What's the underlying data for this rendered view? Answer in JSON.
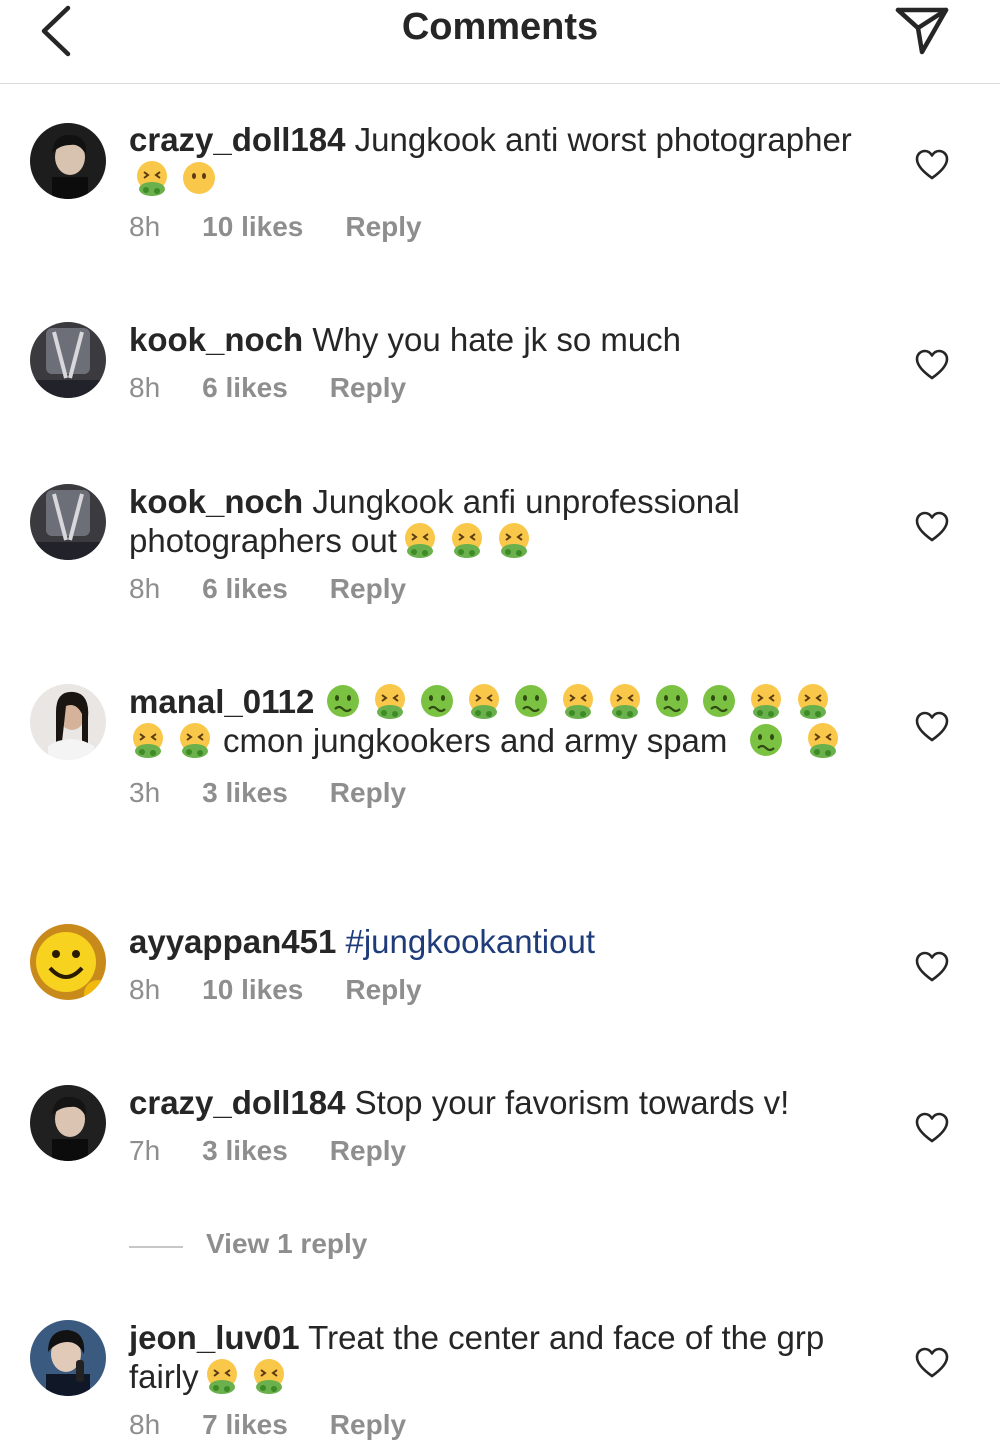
{
  "header": {
    "title": "Comments",
    "back_icon": "chevron-left-icon",
    "send_icon": "paper-plane-icon"
  },
  "colors": {
    "text": "#262626",
    "meta": "#8e8e8e",
    "hashtag": "#1f3c7a",
    "divider": "#dbdbdb"
  },
  "comments": [
    {
      "username": "crazy_doll184",
      "text_parts": [
        "Jungkook anti worst photographer"
      ],
      "emojis_after": [
        "nauseated-face-icon",
        "face-without-mouth-icon"
      ],
      "time": "8h",
      "likes": "10 likes",
      "reply": "Reply"
    },
    {
      "username": "kook_noch",
      "text_parts": [
        "Why you hate jk so much"
      ],
      "time": "8h",
      "likes": "6 likes",
      "reply": "Reply"
    },
    {
      "username": "kook_noch",
      "text_parts": [
        "Jungkook anfi unprofessional photographers out"
      ],
      "emojis_after": [
        "nauseated-face-icon",
        "nauseated-face-icon",
        "nauseated-face-icon"
      ],
      "time": "8h",
      "likes": "6 likes",
      "reply": "Reply"
    },
    {
      "username": "manal_0112",
      "text_parts": [
        "cmon jungkookers and army spam"
      ],
      "time": "3h",
      "likes": "3 likes",
      "reply": "Reply"
    },
    {
      "username": "ayyappan451",
      "hashtag": "#jungkookantiout",
      "time": "8h",
      "likes": "10 likes",
      "reply": "Reply"
    },
    {
      "username": "crazy_doll184",
      "text_parts": [
        "Stop your favorism towards v!"
      ],
      "time": "7h",
      "likes": "3 likes",
      "reply": "Reply",
      "view_replies": "View 1 reply"
    },
    {
      "username": "jeon_luv01",
      "text_parts": [
        "Treat the center and face of the grp fairly"
      ],
      "emojis_after": [
        "nauseated-face-icon",
        "nauseated-face-icon"
      ],
      "time": "8h",
      "likes": "7 likes",
      "reply": "Reply"
    }
  ],
  "icons": {
    "like": "heart-outline-icon",
    "avatar": "avatar"
  }
}
